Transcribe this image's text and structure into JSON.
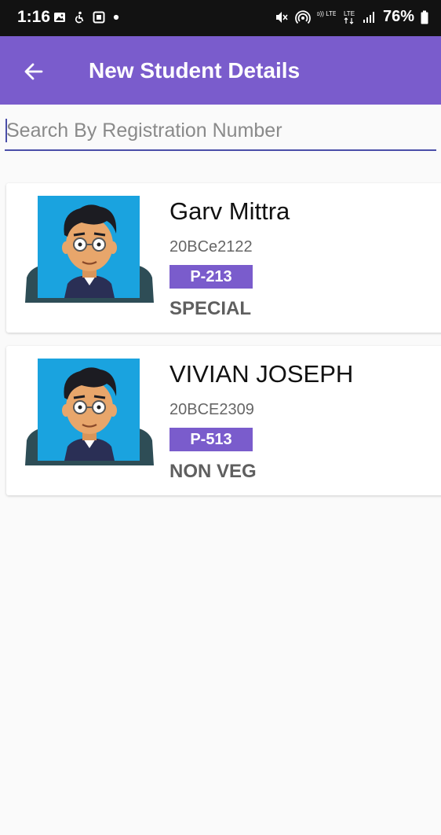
{
  "status_bar": {
    "time": "1:16",
    "battery": "76%",
    "left_icons": [
      "gallery-icon",
      "accessibility-icon",
      "app-icon",
      "dot-icon"
    ],
    "right_icons": [
      "mute-icon",
      "hotspot-icon",
      "volte-lte-icon",
      "lte-data-icon",
      "signal-icon",
      "battery-icon"
    ],
    "volte_label": "Vo)) LTE1",
    "lte_label": "LTE"
  },
  "app_bar": {
    "title": "New Student Details",
    "color": "#7a5ccc"
  },
  "search": {
    "placeholder": "Search By Registration Number",
    "value": ""
  },
  "students": [
    {
      "name": "Garv Mittra",
      "reg_no": "20BCe2122",
      "room": "P-213",
      "meal": "SPECIAL"
    },
    {
      "name": "VIVIAN JOSEPH",
      "reg_no": "20BCE2309",
      "room": "P-513",
      "meal": "NON VEG"
    }
  ]
}
